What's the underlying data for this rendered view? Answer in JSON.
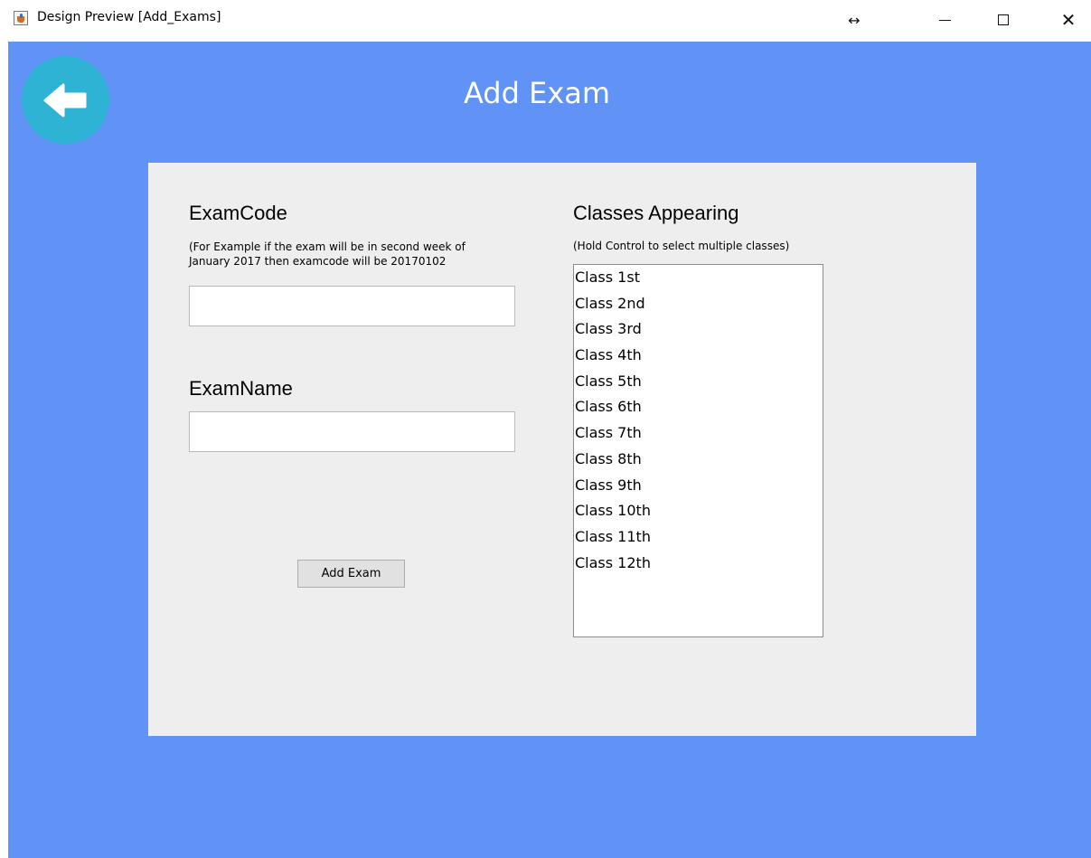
{
  "titlebar": {
    "title": "Design Preview [Add_Exams]",
    "icons": {
      "app": "java-coffee-icon",
      "resize": "resize-arrows-icon",
      "minimize": "minimize-icon",
      "maximize": "maximize-icon",
      "close": "close-icon"
    },
    "resize_glyph": "↔",
    "close_glyph": "✕"
  },
  "colors": {
    "window_bg": "#6093f5",
    "panel_bg": "#eeeeee",
    "back_button": "#2eb3d5",
    "title_text": "#ffffff"
  },
  "header": {
    "back_icon": "arrow-left-icon",
    "title": "Add Exam"
  },
  "form": {
    "exam_code": {
      "label": "ExamCode",
      "hint_line1": "(For Example if the exam will be in second week of",
      "hint_line2": "January 2017 then examcode will be 20170102",
      "value": ""
    },
    "exam_name": {
      "label": "ExamName",
      "value": ""
    },
    "submit_label": "Add Exam"
  },
  "classes": {
    "label": "Classes Appearing",
    "hint": "(Hold Control to select multiple classes)",
    "items": [
      "Class 1st",
      "Class 2nd",
      "Class 3rd",
      "Class 4th",
      "Class 5th",
      "Class 6th",
      "Class 7th",
      "Class 8th",
      "Class 9th",
      "Class 10th",
      "Class 11th",
      "Class 12th"
    ]
  }
}
